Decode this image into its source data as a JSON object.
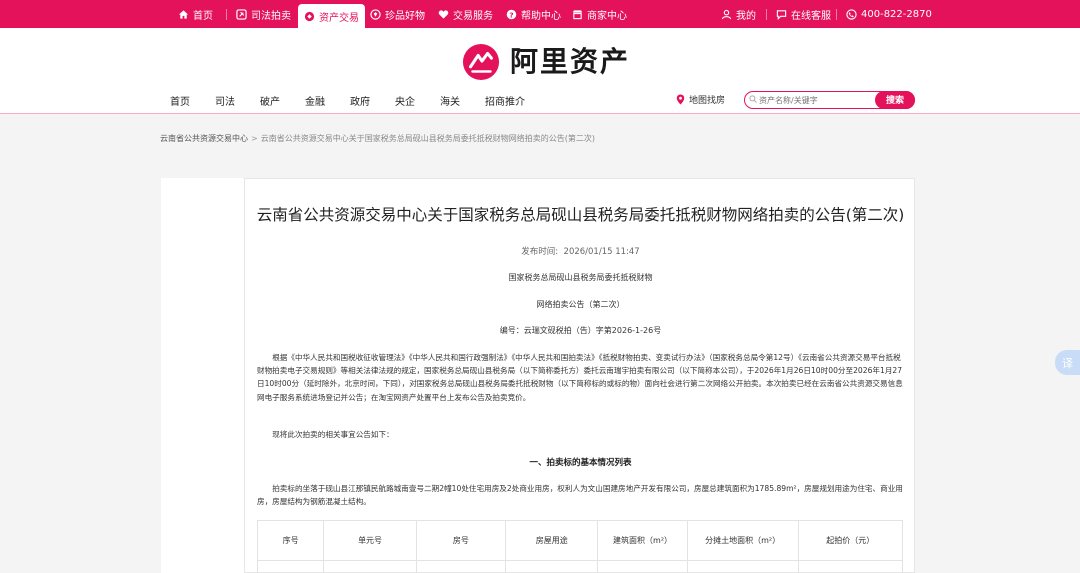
{
  "topnav": {
    "home": "首页",
    "judicial_auction": "司法拍卖",
    "asset_trading": "资产交易",
    "treasures": "珍品好物",
    "trade_service": "交易服务",
    "help_center": "帮助中心",
    "merchant_center": "商家中心",
    "my": "我的",
    "online_service": "在线客服",
    "phone": "400-822-2870"
  },
  "brand": {
    "name": "阿里资产",
    "accent_color": "#e4125b"
  },
  "mainnav": [
    "首页",
    "司法",
    "破产",
    "金融",
    "政府",
    "央企",
    "海关",
    "招商推介"
  ],
  "map_search": "地图找房",
  "search": {
    "placeholder": "资产名称/关键字",
    "button": "搜索"
  },
  "breadcrumb": {
    "root": "云南省公共资源交易中心",
    "separator": ">",
    "current": "云南省公共资源交易中心关于国家税务总局砚山县税务局委托抵税财物网络拍卖的公告(第二次)"
  },
  "article": {
    "title": "云南省公共资源交易中心关于国家税务总局砚山县税务局委托抵税财物网络拍卖的公告(第二次)",
    "pub_label": "发布时间:",
    "pub_time": "2026/01/15 11:47",
    "line1": "国家税务总局砚山县税务局委托抵税财物",
    "line2": "网络拍卖公告（第二次）",
    "line3": "编号：云瑞文砚税拍（告）字第2026-1-26号",
    "para1": "根据《中华人民共和国税收征收管理法》《中华人民共和国行政强制法》《中华人民共和国拍卖法》《抵税财物拍卖、变卖试行办法》（国家税务总局令第12号）《云南省公共资源交易平台抵税财物拍卖电子交易规则》等相关法律法规的规定，国家税务总局砚山县税务局（以下简称委托方）委托云南瑞宇拍卖有限公司（以下简称本公司），于2026年1月26日10时00分至2026年1月27日10时00分（延时除外，北京时间，下同），对国家税务总局砚山县税务局委托抵税财物（以下简称标的或标的物）面向社会进行第二次网络公开拍卖。本次拍卖已经在云南省公共资源交易信息网电子服务系统进场登记并公告；在淘宝网资产处置平台上发布公告及拍卖竞价。",
    "para2": "现将此次拍卖的相关事宜公告如下：",
    "section1": "一、拍卖标的基本情况列表",
    "para3": "拍卖标的坐落于砚山县江那镇民航路城南壹号二期2幢10处住宅用房及2处商业用房，权利人为文山国建房地产开发有限公司，房屋总建筑面积为1785.89m²，房屋规划用途为住宅、商业用房，房屋结构为钢筋混凝土结构。",
    "table_headers": [
      "序号",
      "单元号",
      "房号",
      "房屋用途",
      "建筑面积（m²）",
      "分摊土地面积（m²）",
      "起拍价（元）"
    ]
  },
  "float_button": "译"
}
